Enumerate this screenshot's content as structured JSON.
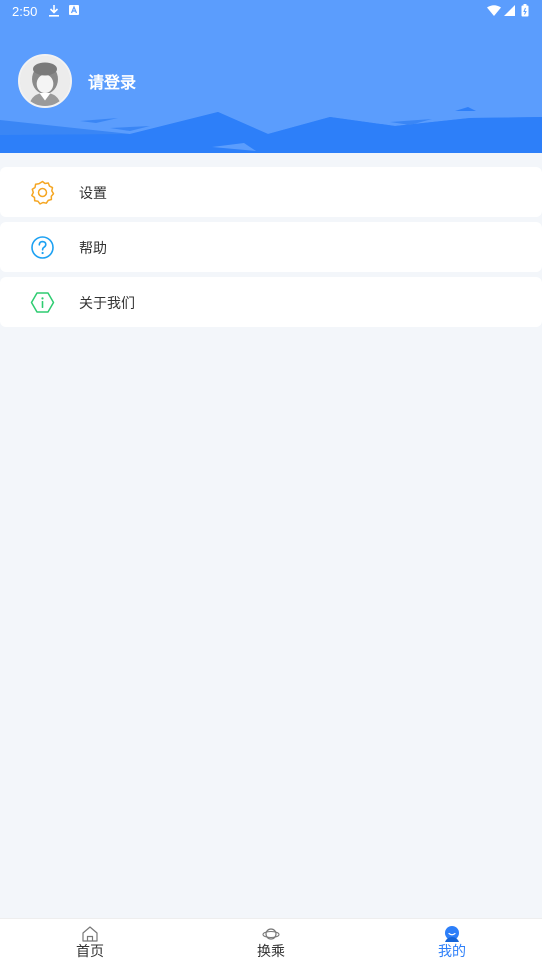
{
  "status_bar": {
    "time": "2:50"
  },
  "profile": {
    "login_label": "请登录"
  },
  "menu": {
    "items": [
      {
        "label": "设置",
        "icon": "gear-icon",
        "color": "#f5a623"
      },
      {
        "label": "帮助",
        "icon": "help-circle-icon",
        "color": "#1da1f2"
      },
      {
        "label": "关于我们",
        "icon": "info-hexagon-icon",
        "color": "#2ecc71"
      }
    ]
  },
  "bottom_nav": {
    "items": [
      {
        "label": "首页",
        "icon": "home-icon",
        "active": false
      },
      {
        "label": "换乘",
        "icon": "transfer-icon",
        "active": false
      },
      {
        "label": "我的",
        "icon": "profile-icon",
        "active": true
      }
    ]
  },
  "colors": {
    "header": "#5b9dfd",
    "accent": "#2d7ff9",
    "background": "#f3f6fa"
  }
}
